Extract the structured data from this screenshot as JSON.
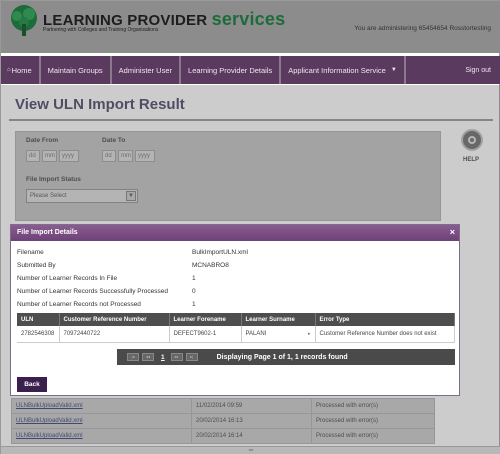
{
  "header": {
    "brand_main": "LEARNING PROVIDER",
    "brand_services": "services",
    "tagline": "Partnering with Colleges and Training Organisations",
    "admin_text": "You are administering 65454654 Rosstortesting"
  },
  "nav": {
    "home": "Home",
    "maintain_groups": "Maintain Groups",
    "administer_user": "Administer User",
    "learning_provider_details": "Learning Provider Details",
    "applicant_information_service": "Applicant Information Service",
    "sign_out": "Sign out"
  },
  "page": {
    "title": "View ULN Import Result",
    "date_from_label": "Date From",
    "date_to_label": "Date To",
    "dd": "dd",
    "mm": "mm",
    "yyyy": "yyyy",
    "file_import_status_label": "File Import Status",
    "status_select_value": "Please Select",
    "help_label": "HELP"
  },
  "bg_rows": [
    {
      "file": "ULNBulkUploadValid.xml",
      "date": "11/02/2014 09:59",
      "status": "Processed with error(s)"
    },
    {
      "file": "ULNBulkUploadValid.xml",
      "date": "20/02/2014 16:13",
      "status": "Processed with error(s)"
    },
    {
      "file": "ULNBulkUploadValid.xml",
      "date": "20/02/2014 16:14",
      "status": "Processed with error(s)"
    }
  ],
  "modal": {
    "title": "File Import Details",
    "close": "×",
    "filename_label": "Filename",
    "filename_value": "BulkImportULN.xml",
    "submitted_by_label": "Submitted By",
    "submitted_by_value": "MCNABRO8",
    "records_in_file_label": "Number of Learner Records In File",
    "records_in_file_value": "1",
    "records_success_label": "Number of Learner Records Successfully Processed",
    "records_success_value": "0",
    "records_not_processed_label": "Number of Learner Records not Processed",
    "records_not_processed_value": "1",
    "table": {
      "headers": [
        "ULN",
        "Customer Reference Number",
        "Learner Forename",
        "Learner Surname",
        "Error Type"
      ],
      "rows": [
        [
          "2782546308",
          "70972440722",
          "DEFECT9602-1",
          "PALANI",
          "Customer Reference Number does not exist"
        ]
      ]
    },
    "pager": {
      "current_page": "1",
      "info": "Displaying Page 1 of 1, 1 records found"
    },
    "back_label": "Back"
  }
}
